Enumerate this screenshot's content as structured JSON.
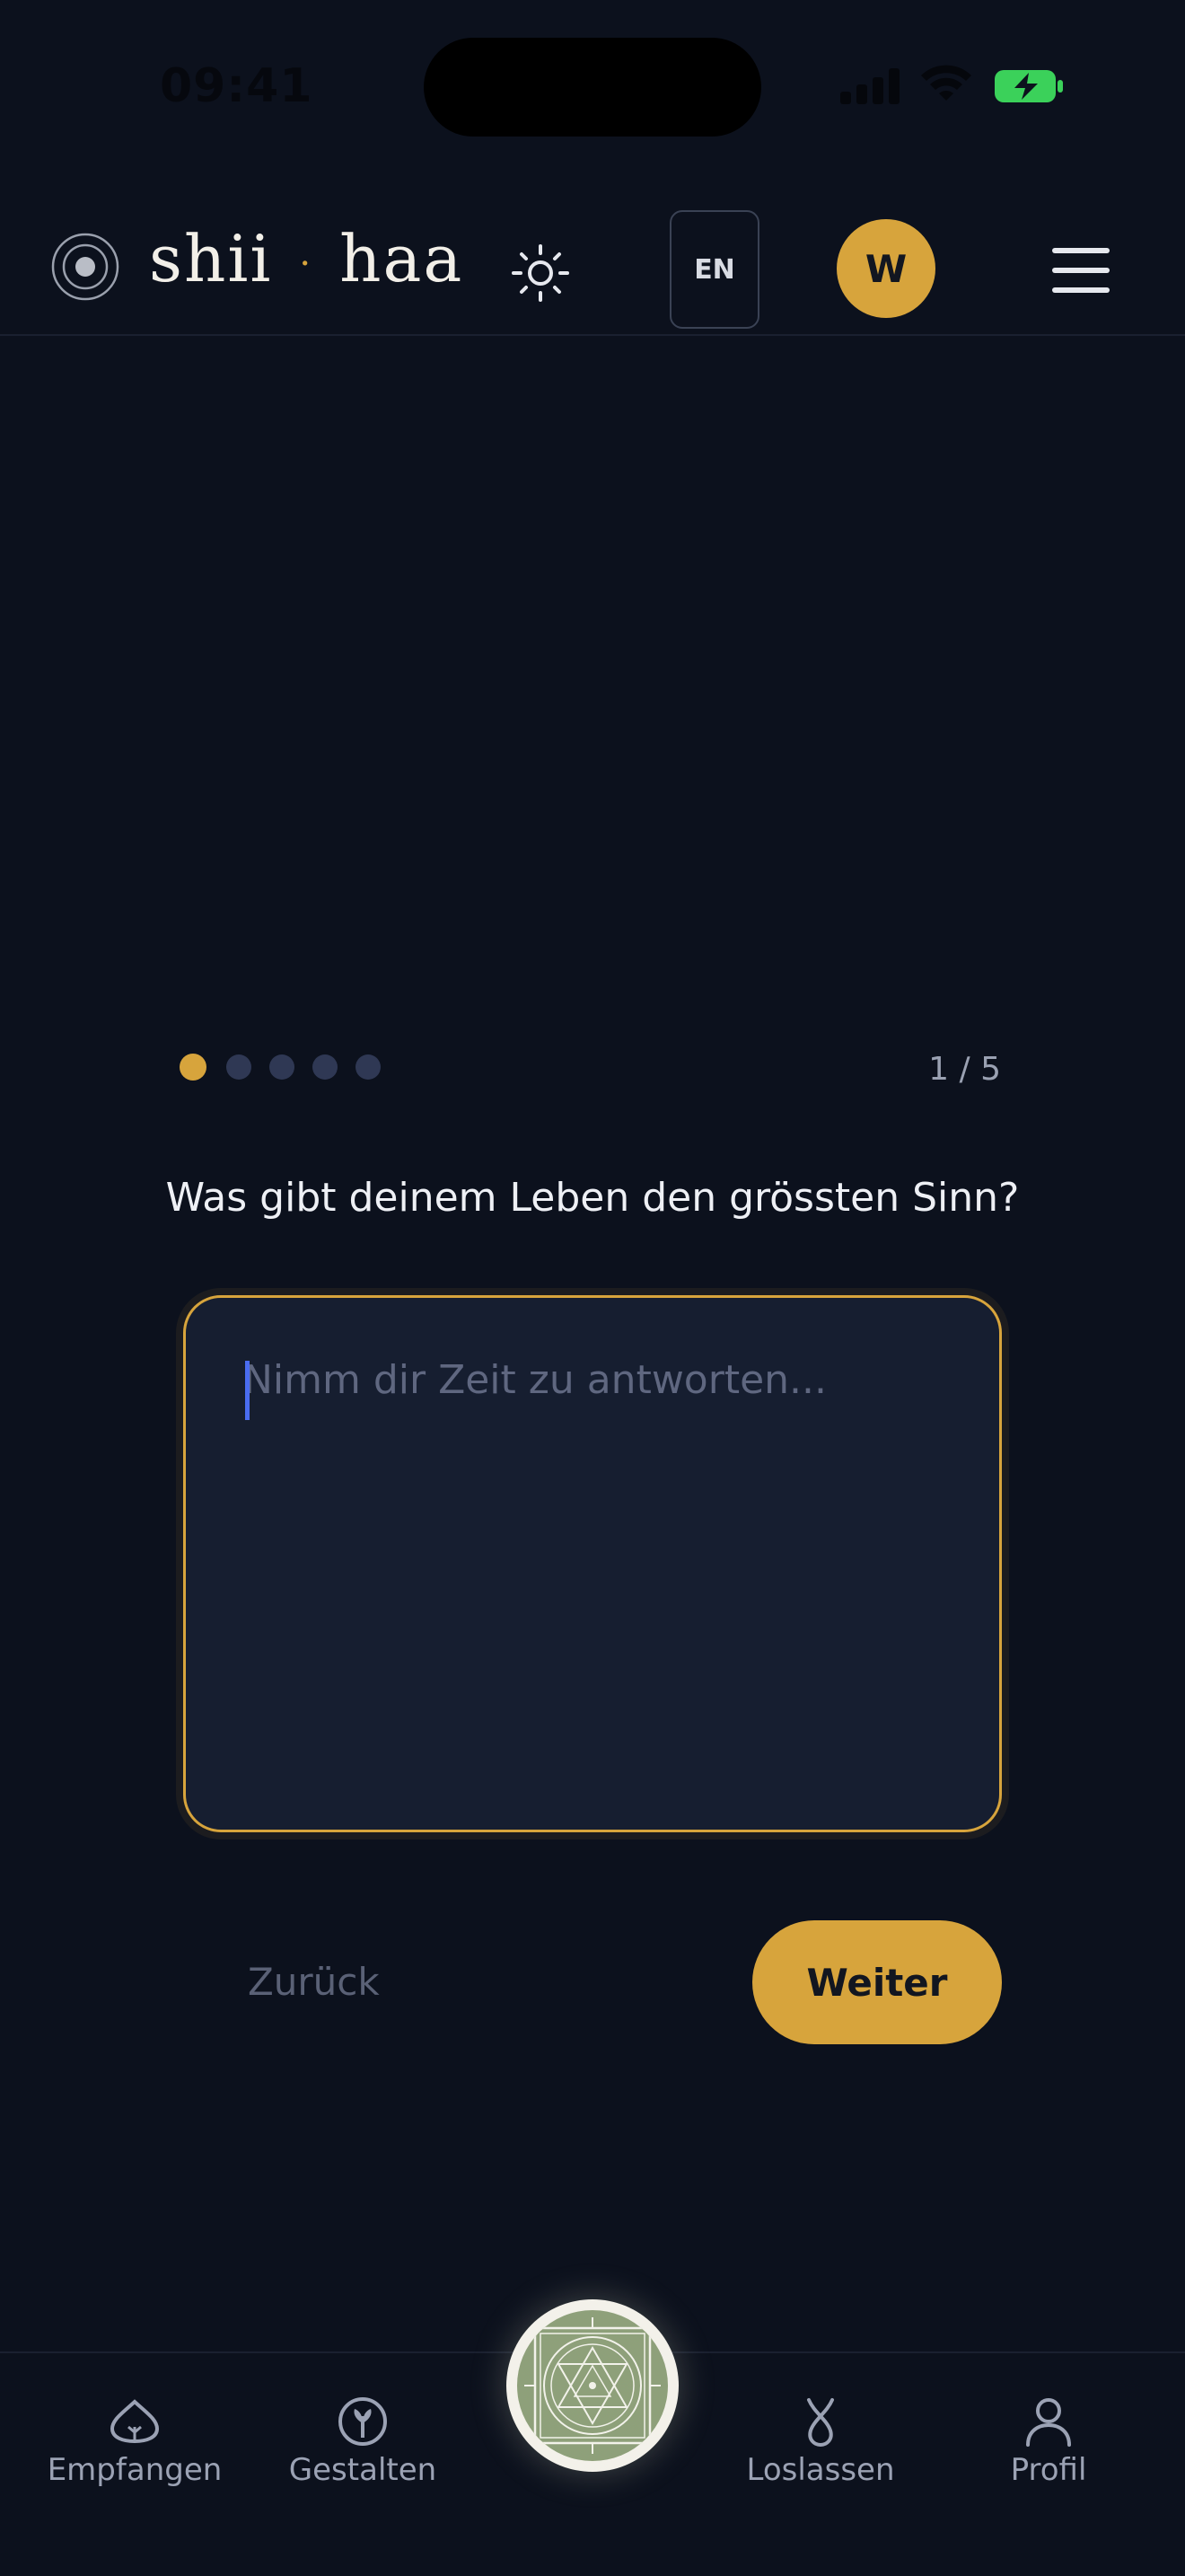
{
  "status_bar": {
    "time": "09:41"
  },
  "header": {
    "logo_left": "shii",
    "logo_separator": "·",
    "logo_right": "haa",
    "language": "EN",
    "avatar_initial": "W"
  },
  "progress": {
    "current_step": 1,
    "total_steps": 5,
    "counter": "1 / 5"
  },
  "question": "Was gibt deinem Leben den grössten Sinn?",
  "answer": {
    "value": "",
    "placeholder": "Nimm dir Zeit zu antworten..."
  },
  "actions": {
    "back_label": "Zurück",
    "next_label": "Weiter"
  },
  "bottom_nav": {
    "items": [
      {
        "label": "Empfangen",
        "icon": "lotus-icon"
      },
      {
        "label": "Gestalten",
        "icon": "sprout-icon"
      },
      {
        "label": "",
        "icon": "yantra-mandala-icon"
      },
      {
        "label": "Loslassen",
        "icon": "release-icon"
      },
      {
        "label": "Profil",
        "icon": "user-icon"
      }
    ]
  },
  "colors": {
    "background": "#0c111d",
    "accent": "#d7a43c",
    "input_bg": "#161e30",
    "inactive_dot": "#2f3854"
  }
}
